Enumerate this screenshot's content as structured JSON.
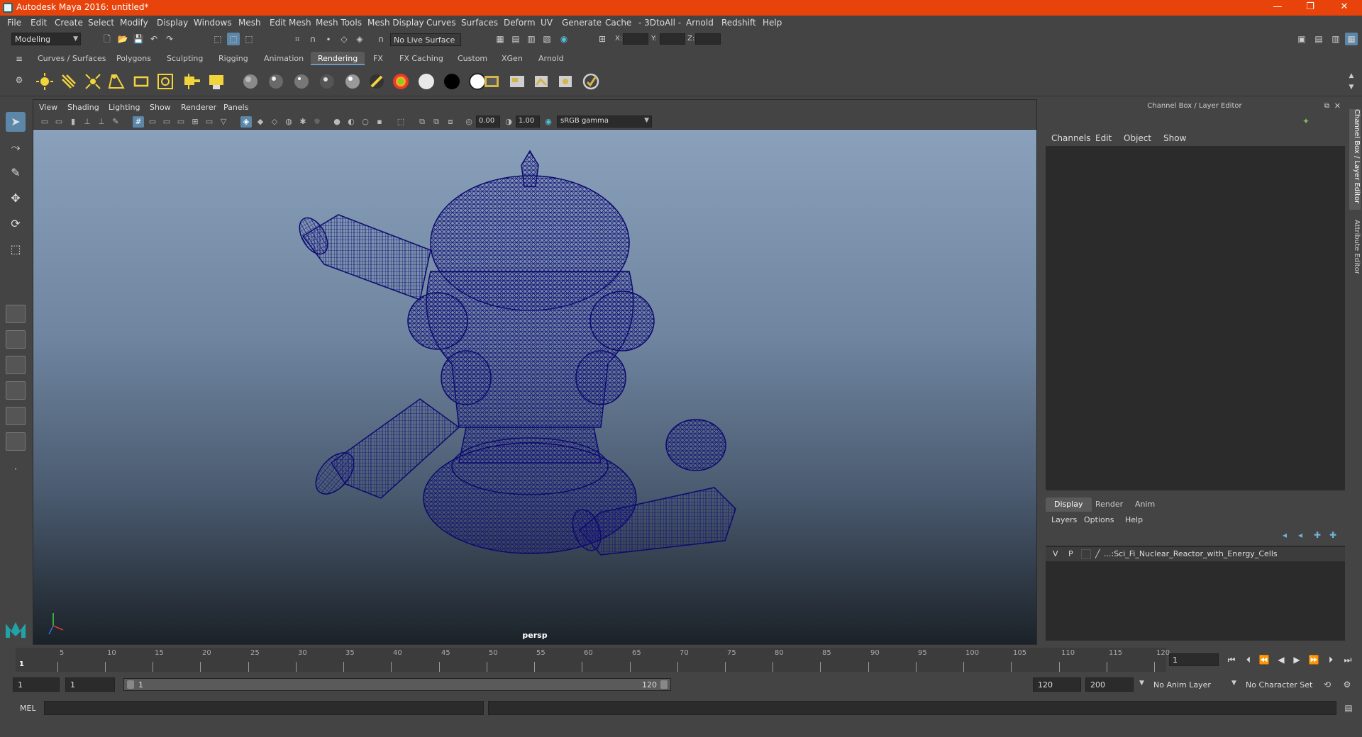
{
  "window": {
    "title": "Autodesk Maya 2016: untitled*",
    "min": "—",
    "max": "❐",
    "close": "✕"
  },
  "menubar": [
    "File",
    "Edit",
    "Create",
    "Select",
    "Modify",
    "Display",
    "Windows",
    "Mesh",
    "Edit Mesh",
    "Mesh Tools",
    "Mesh Display",
    "Curves",
    "Surfaces",
    "Deform",
    "UV",
    "Generate",
    "Cache",
    "- 3DtoAll -",
    "Arnold",
    "Redshift",
    "Help"
  ],
  "statusline": {
    "menuset": "Modeling",
    "live_surface": "No Live Surface",
    "x_label": "X:",
    "y_label": "Y:",
    "z_label": "Z:"
  },
  "shelf": {
    "tabs": [
      "Curves / Surfaces",
      "Polygons",
      "Sculpting",
      "Rigging",
      "Animation",
      "Rendering",
      "FX",
      "FX Caching",
      "Custom",
      "XGen",
      "Arnold"
    ],
    "active_tab": "Rendering"
  },
  "viewport": {
    "menu": [
      "View",
      "Shading",
      "Lighting",
      "Show",
      "Renderer",
      "Panels"
    ],
    "exposure": "0.00",
    "gamma": "1.00",
    "color_space": "sRGB gamma",
    "camera": "persp",
    "wire_color": "#0d0a6e"
  },
  "channel_box": {
    "title": "Channel Box / Layer Editor",
    "menu": [
      "Channels",
      "Edit",
      "Object",
      "Show"
    ]
  },
  "layer_editor": {
    "tabs": [
      "Display",
      "Render",
      "Anim"
    ],
    "active_tab": "Display",
    "menu": [
      "Layers",
      "Options",
      "Help"
    ],
    "layer": {
      "v": "V",
      "p": "P",
      "name": "...:Sci_Fi_Nuclear_Reactor_with_Energy_Cells"
    }
  },
  "side_tabs": [
    "Channel Box / Layer Editor",
    "Attribute Editor"
  ],
  "timeline": {
    "ticks": [
      5,
      10,
      15,
      20,
      25,
      30,
      35,
      40,
      45,
      50,
      55,
      60,
      65,
      70,
      75,
      80,
      85,
      90,
      95,
      100,
      105,
      110,
      115,
      120
    ],
    "first": "1",
    "current_frame": "1"
  },
  "range": {
    "start": "1",
    "playback_start": "1",
    "range_start_label": "1",
    "range_end_label": "120",
    "playback_end": "120",
    "end": "200",
    "anim_layer": "No Anim Layer",
    "character_set": "No Character Set"
  },
  "command_line": {
    "label": "MEL"
  }
}
